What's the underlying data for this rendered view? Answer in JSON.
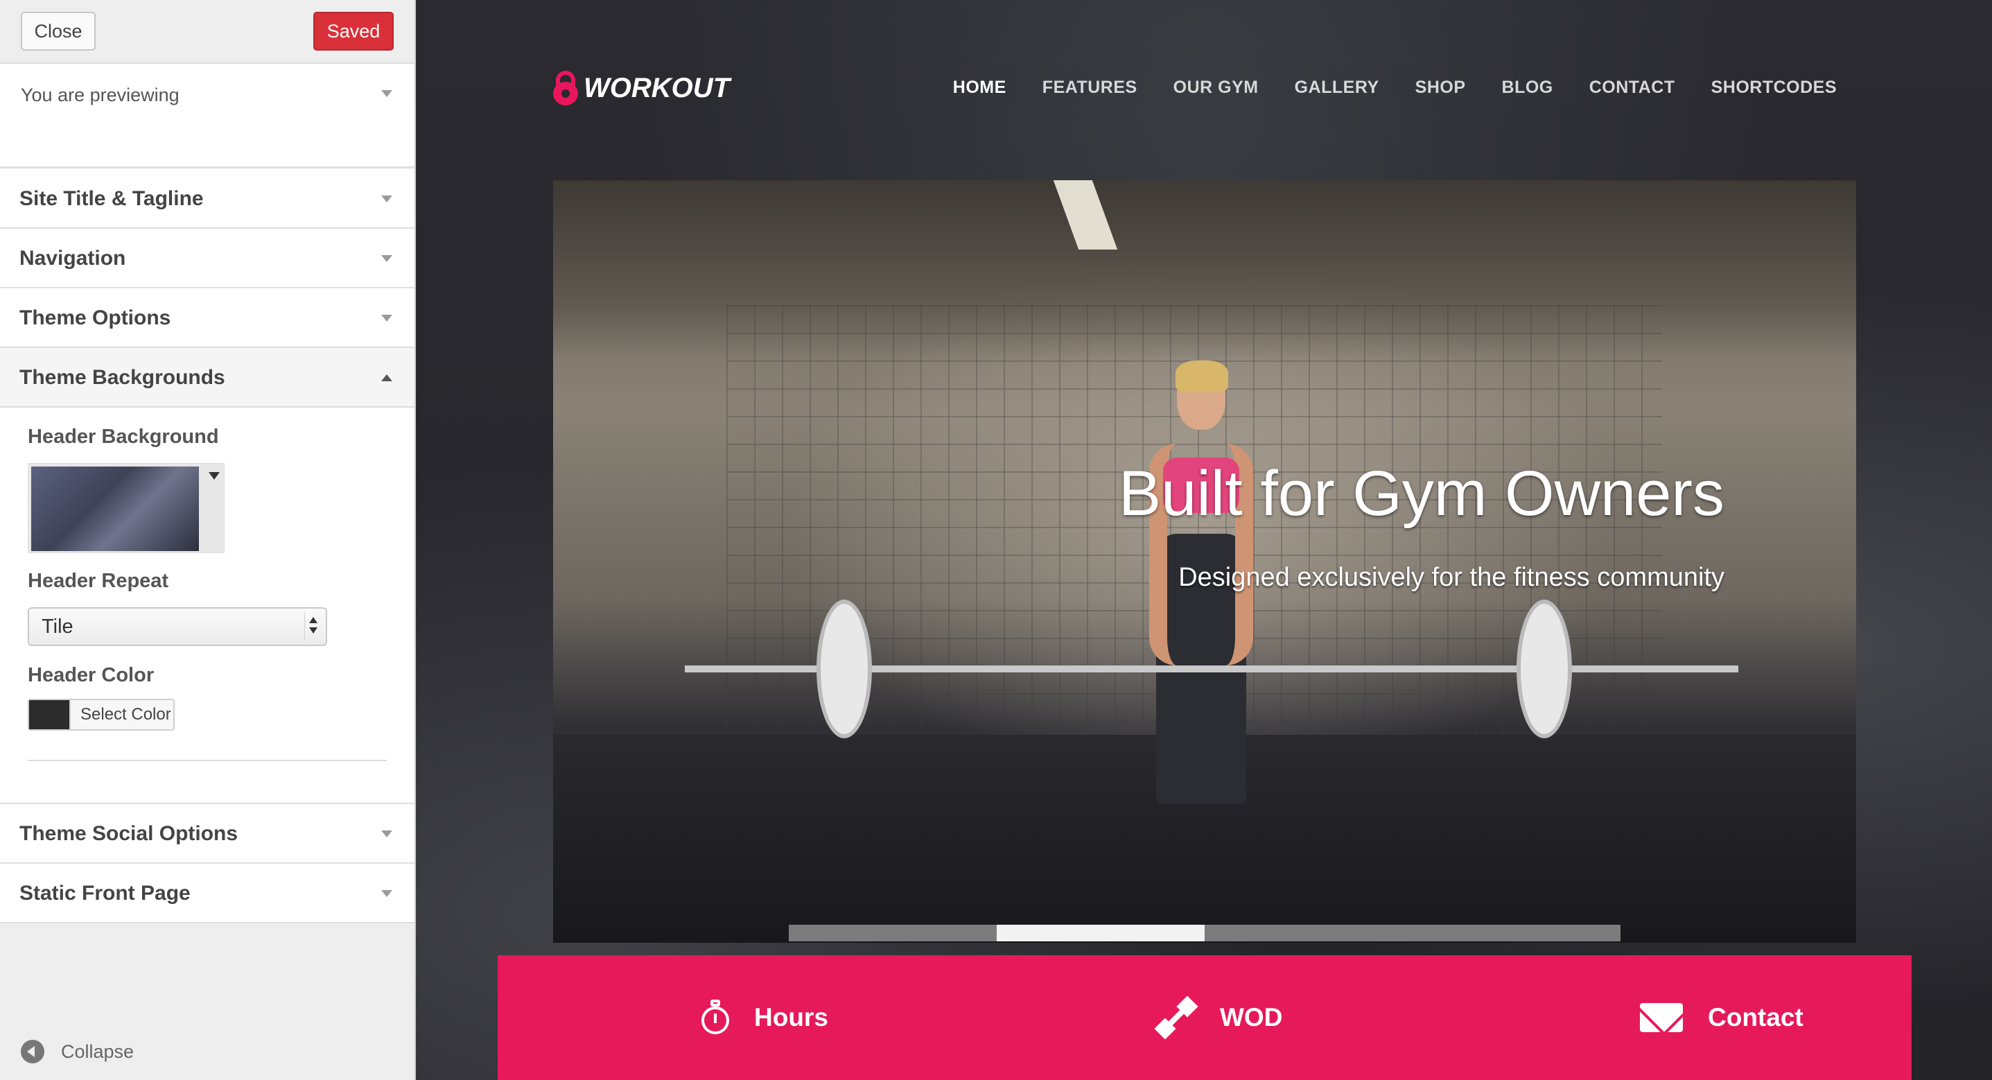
{
  "sidebar": {
    "close_label": "Close",
    "saved_label": "Saved",
    "previewing_label": "You are previewing",
    "sections": [
      {
        "title": "Site Title & Tagline"
      },
      {
        "title": "Navigation"
      },
      {
        "title": "Theme Options"
      },
      {
        "title": "Theme Backgrounds"
      },
      {
        "title": "Theme Social Options"
      },
      {
        "title": "Static Front Page"
      }
    ],
    "backgrounds": {
      "header_background_label": "Header Background",
      "header_repeat_label": "Header Repeat",
      "header_repeat_value": "Tile",
      "header_color_label": "Header Color",
      "header_color_value": "#2b2b2b",
      "select_color_label": "Select Color"
    },
    "collapse_label": "Collapse"
  },
  "site": {
    "logo_text": "WORKOUT",
    "nav": [
      "HOME",
      "FEATURES",
      "OUR GYM",
      "GALLERY",
      "SHOP",
      "BLOG",
      "CONTACT",
      "SHORTCODES"
    ],
    "active_nav": "HOME",
    "hero_title": "Built for Gym Owners",
    "hero_subtitle": "Designed exclusively for the fitness community",
    "slider": {
      "count": 4,
      "active_index": 1
    },
    "cta": [
      {
        "label": "Hours",
        "icon": "stopwatch-icon"
      },
      {
        "label": "WOD",
        "icon": "dumbbell-icon"
      },
      {
        "label": "Contact",
        "icon": "envelope-icon"
      }
    ],
    "colors": {
      "accent": "#e6195b",
      "saved_button": "#d9303a"
    }
  }
}
